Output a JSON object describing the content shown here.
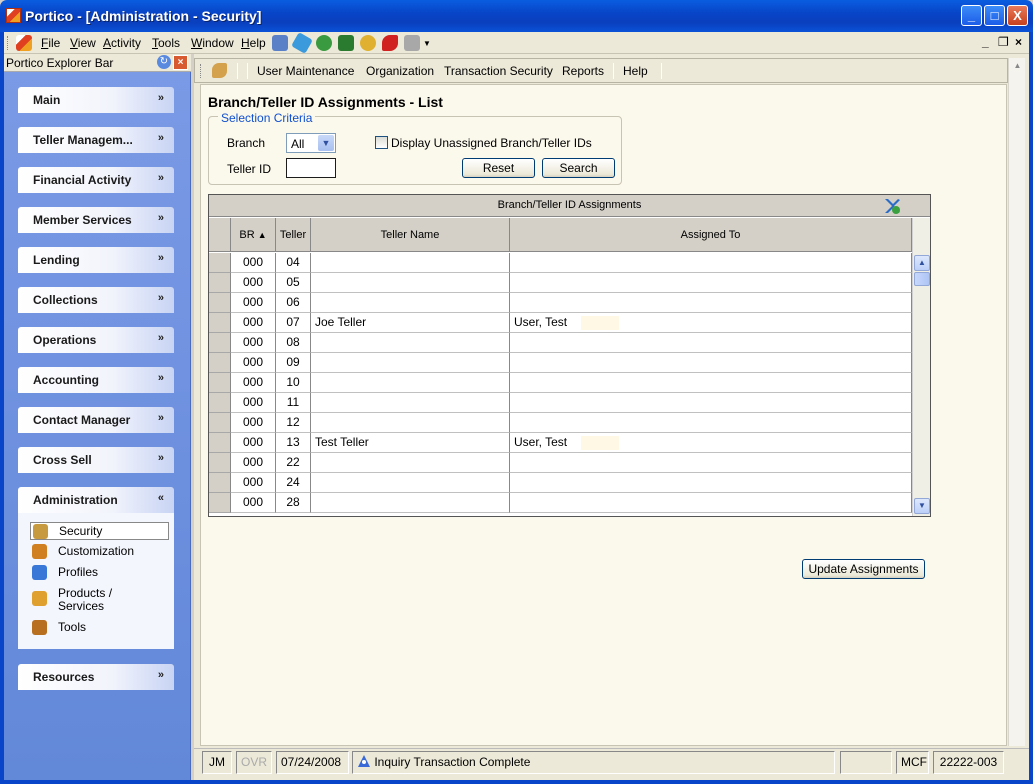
{
  "window": {
    "title": "Portico - [Administration - Security]",
    "min": "_",
    "max": "□",
    "close": "X"
  },
  "menubar": {
    "items": [
      "File",
      "View",
      "Activity",
      "Tools",
      "Window",
      "Help"
    ],
    "underline": [
      "F",
      "V",
      "A",
      "T",
      "W",
      "H"
    ],
    "rest": [
      "ile",
      "iew",
      "ctivity",
      "ools",
      "indow",
      "elp"
    ],
    "right_controls": [
      "_",
      "×",
      "×"
    ]
  },
  "explorer": {
    "title": "Portico Explorer Bar",
    "groups": [
      {
        "label": "Main",
        "chevron": "»"
      },
      {
        "label": "Teller Managem...",
        "chevron": "»"
      },
      {
        "label": "Financial Activity",
        "chevron": "»"
      },
      {
        "label": "Member Services",
        "chevron": "»"
      },
      {
        "label": "Lending",
        "chevron": "»"
      },
      {
        "label": "Collections",
        "chevron": "»"
      },
      {
        "label": "Operations",
        "chevron": "»"
      },
      {
        "label": "Accounting",
        "chevron": "»"
      },
      {
        "label": "Contact Manager",
        "chevron": "»"
      },
      {
        "label": "Cross Sell",
        "chevron": "»"
      },
      {
        "label": "Administration",
        "chevron": "«"
      },
      {
        "label": "Resources",
        "chevron": "»"
      }
    ],
    "admin_items": [
      {
        "label": "Security",
        "icon": "keys-icon",
        "color": "#c89a40"
      },
      {
        "label": "Customization",
        "icon": "wrench-icon",
        "color": "#d08020"
      },
      {
        "label": "Profiles",
        "icon": "profile-icon",
        "color": "#3a78d8"
      },
      {
        "label": "Products /",
        "label2": "Services",
        "icon": "products-icon",
        "color": "#e0a030"
      },
      {
        "label": "Tools",
        "icon": "toolbox-icon",
        "color": "#b87020"
      }
    ]
  },
  "toolbar2": {
    "links": [
      "User Maintenance",
      "Organization",
      "Transaction Security",
      "Reports",
      "Help"
    ]
  },
  "page": {
    "title": "Branch/Teller ID Assignments - List",
    "criteria_legend": "Selection Criteria",
    "branch_label": "Branch",
    "branch_value": "All",
    "teller_label": "Teller ID",
    "teller_value": "",
    "display_unassigned_label": "Display Unassigned Branch/Teller IDs",
    "display_unassigned_checked": false,
    "reset_label": "Reset",
    "search_label": "Search",
    "update_label": "Update Assignments"
  },
  "grid": {
    "caption": "Branch/Teller ID Assignments",
    "headers": {
      "br": "BR",
      "sort": "▲",
      "teller": "Teller",
      "name": "Teller Name",
      "assigned": "Assigned To"
    },
    "rows": [
      {
        "br": "000",
        "teller": "04",
        "name": "",
        "assigned": ""
      },
      {
        "br": "000",
        "teller": "05",
        "name": "",
        "assigned": ""
      },
      {
        "br": "000",
        "teller": "06",
        "name": "",
        "assigned": ""
      },
      {
        "br": "000",
        "teller": "07",
        "name": "Joe Teller",
        "assigned": "User, Test"
      },
      {
        "br": "000",
        "teller": "08",
        "name": "",
        "assigned": ""
      },
      {
        "br": "000",
        "teller": "09",
        "name": "",
        "assigned": ""
      },
      {
        "br": "000",
        "teller": "10",
        "name": "",
        "assigned": ""
      },
      {
        "br": "000",
        "teller": "11",
        "name": "",
        "assigned": ""
      },
      {
        "br": "000",
        "teller": "12",
        "name": "",
        "assigned": ""
      },
      {
        "br": "000",
        "teller": "13",
        "name": "Test Teller",
        "assigned": "User, Test"
      },
      {
        "br": "000",
        "teller": "22",
        "name": "",
        "assigned": ""
      },
      {
        "br": "000",
        "teller": "24",
        "name": "",
        "assigned": ""
      },
      {
        "br": "000",
        "teller": "28",
        "name": "",
        "assigned": ""
      }
    ]
  },
  "statusbar": {
    "user": "JM",
    "ovr": "OVR",
    "date": "07/24/2008",
    "message": "Inquiry Transaction Complete",
    "blank": "",
    "code": "MCF",
    "account": "22222-003"
  }
}
